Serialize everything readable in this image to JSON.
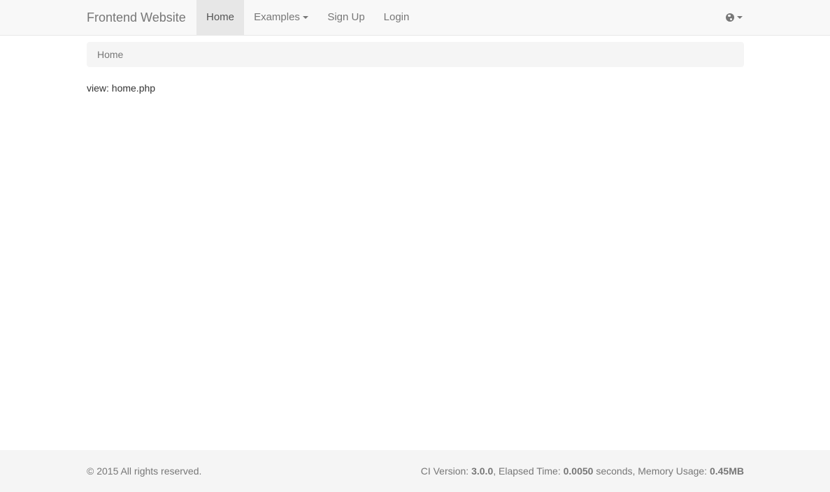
{
  "navbar": {
    "brand": "Frontend Website",
    "items": [
      {
        "label": "Home",
        "active": true
      },
      {
        "label": "Examples",
        "dropdown": true
      },
      {
        "label": "Sign Up"
      },
      {
        "label": "Login"
      }
    ],
    "language_icon": "globe-icon"
  },
  "breadcrumb": {
    "current": "Home"
  },
  "main": {
    "text": "view: home.php"
  },
  "footer": {
    "copyright": "© 2015 All rights reserved.",
    "ci_version_label": "CI Version: ",
    "ci_version": "3.0.0",
    "elapsed_label": ", Elapsed Time: ",
    "elapsed_time": "0.0050",
    "seconds_label": " seconds, Memory Usage: ",
    "memory_usage": "0.45MB"
  },
  "colors": {
    "navbar_bg": "#f8f8f8",
    "active_tab_bg": "#e7e7e7",
    "nav_text": "#777777",
    "breadcrumb_bg": "#f5f5f5",
    "footer_bg": "#f5f5f5"
  }
}
